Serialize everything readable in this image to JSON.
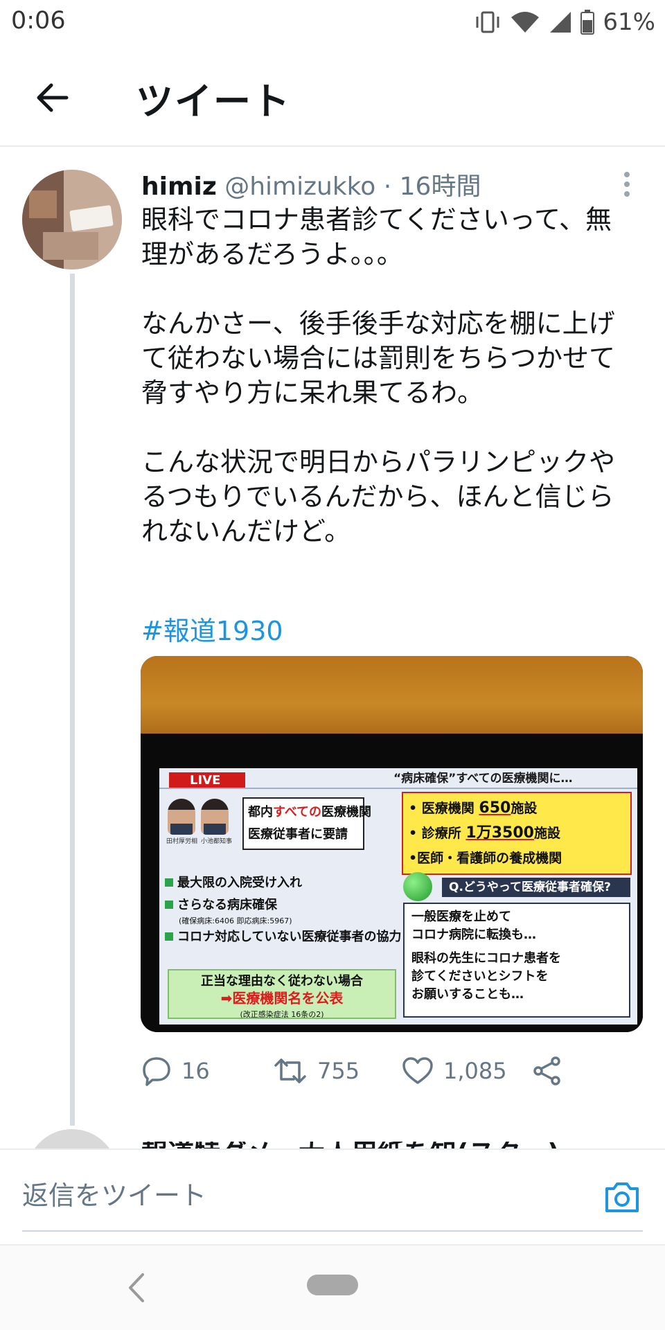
{
  "status_bar": {
    "time": "0:06",
    "battery": "61%"
  },
  "header": {
    "title": "ツイート"
  },
  "tweet": {
    "author_name": "himiz",
    "author_handle": "@himizukko",
    "separator": "·",
    "time": "16時間",
    "paragraphs": [
      "眼科でコロナ患者診てくださいって、無\n理があるだろうよ。。。",
      "なんかさー、後手後手な対応を棚に上げ\nて従わない場合には罰則をちらつかせて\n脅すやり方に呆れ果てるわ。",
      "こんな状況で明日からパラリンピックや\nるつもりでいるんだから、ほんと信じら\nれないんだけど。"
    ],
    "hashtag": "#報道1930",
    "media": {
      "live": "LIVE",
      "top_caption": "“病床確保”すべての医療機関に…",
      "person_1": "田村厚労相",
      "person_2": "小池都知事",
      "box_a_prefix": "都内",
      "box_a_emph": "すべての",
      "box_a_suffix": "医療機関",
      "box_a_line2": "医療従事者に要請",
      "b1_label": "医療機関",
      "b1_value": "650",
      "b1_unit": "施設",
      "b2_label": "診療所",
      "b2_value": "1万3500",
      "b2_unit": "施設",
      "b3": "医師・看護師の養成機関",
      "list_1": "最大限の入院受け入れ",
      "list_2": "さらなる病床確保",
      "list_2_note": "(確保病床:6406 即応病床:5967)",
      "list_3": "コロナ対応していない医療従事者の協力",
      "question": "Q.どうやって医療従事者確保?",
      "ans_1": "一般医療を止めて",
      "ans_2": "コロナ病院に転換も…",
      "ans_3": "眼科の先生にコロナ患者を",
      "ans_4": "診てくださいとシフトを",
      "ans_5": "お願いすることも…",
      "penalty_1": "正当な理由なく従わない場合",
      "penalty_2": "➡医療機関名を公表",
      "penalty_3": "(改正感染症法 16条の2)"
    },
    "replies": "16",
    "retweets": "755",
    "likes": "1,085"
  },
  "next_reply": {
    "text": "報道特ダメ・大人用紙を知(スター)"
  },
  "composer": {
    "placeholder": "返信をツイート"
  },
  "colors": {
    "link": "#1b95e0",
    "icon_gray": "#657786"
  }
}
